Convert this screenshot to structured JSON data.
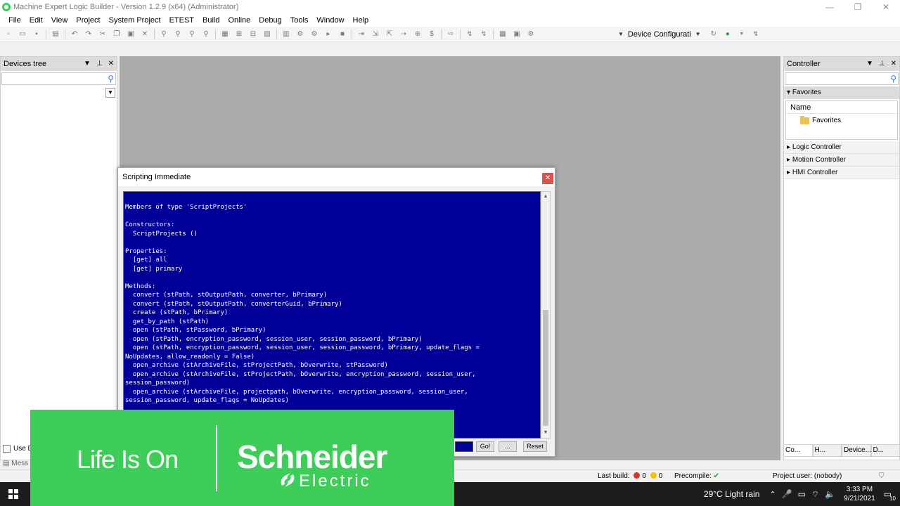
{
  "window": {
    "title": "Machine Expert Logic Builder - Version 1.2.9 (x64) (Administrator)",
    "controls": [
      "—",
      "❐",
      "✕"
    ]
  },
  "menu": [
    "File",
    "Edit",
    "View",
    "Project",
    "System Project",
    "ETEST",
    "Build",
    "Online",
    "Debug",
    "Tools",
    "Window",
    "Help"
  ],
  "toolbar": {
    "device_combo": "Device Configurati"
  },
  "devices_panel": {
    "title": "Devices tree",
    "use_label": "Use D",
    "messages_label": "Mess"
  },
  "controller_panel": {
    "title": "Controller",
    "favorites_section": "Favorites",
    "name_header": "Name",
    "favorites_item": "Favorites",
    "sections": [
      "Logic Controller",
      "Motion Controller",
      "HMI Controller"
    ],
    "bottom_tabs": [
      "Co...",
      "H...",
      "Device...",
      "D..."
    ]
  },
  "dialog": {
    "title": "Scripting Immediate",
    "console_text": "Members of type 'ScriptProjects'\n\nConstructors:\n  ScriptProjects ()\n\nProperties:\n  [get] all\n  [get] primary\n\nMethods:\n  convert (stPath, stOutputPath, converter, bPrimary)\n  convert (stPath, stOutputPath, converterGuid, bPrimary)\n  create (stPath, bPrimary)\n  get_by_path (stPath)\n  open (stPath, stPassword, bPrimary)\n  open (stPath, encryption_password, session_user, session_password, bPrimary)\n  open (stPath, encryption_password, session_user, session_password, bPrimary, update_flags =\nNoUpdates, allow_readonly = False)\n  open_archive (stArchiveFile, stProjectPath, bOverwrite, stPassword)\n  open_archive (stArchiveFile, stProjectPath, bOverwrite, encryption_password, session_user,\nsession_password)\n  open_archive (stArchiveFile, projectpath, bOverwrite, encryption_password, session_user,\nsession_password, update_flags = NoUpdates)",
    "go_label": "Go!",
    "ellipsis_label": "...",
    "reset_label": "Reset"
  },
  "statusbar": {
    "last_build": "Last build:",
    "errors": "0",
    "warnings": "0",
    "precompile": "Precompile:",
    "project_user": "Project user: (nobody)"
  },
  "taskbar": {
    "weather": "29°C  Light rain",
    "time": "3:33 PM",
    "date": "9/21/2021",
    "notifications": "10"
  },
  "banner": {
    "tagline": "Life Is On",
    "brand": "Schneider",
    "brand_sub": "Electric"
  },
  "colors": {
    "console_bg": "#000099",
    "brand_green": "#3dcd58",
    "close_red": "#d9534f"
  }
}
